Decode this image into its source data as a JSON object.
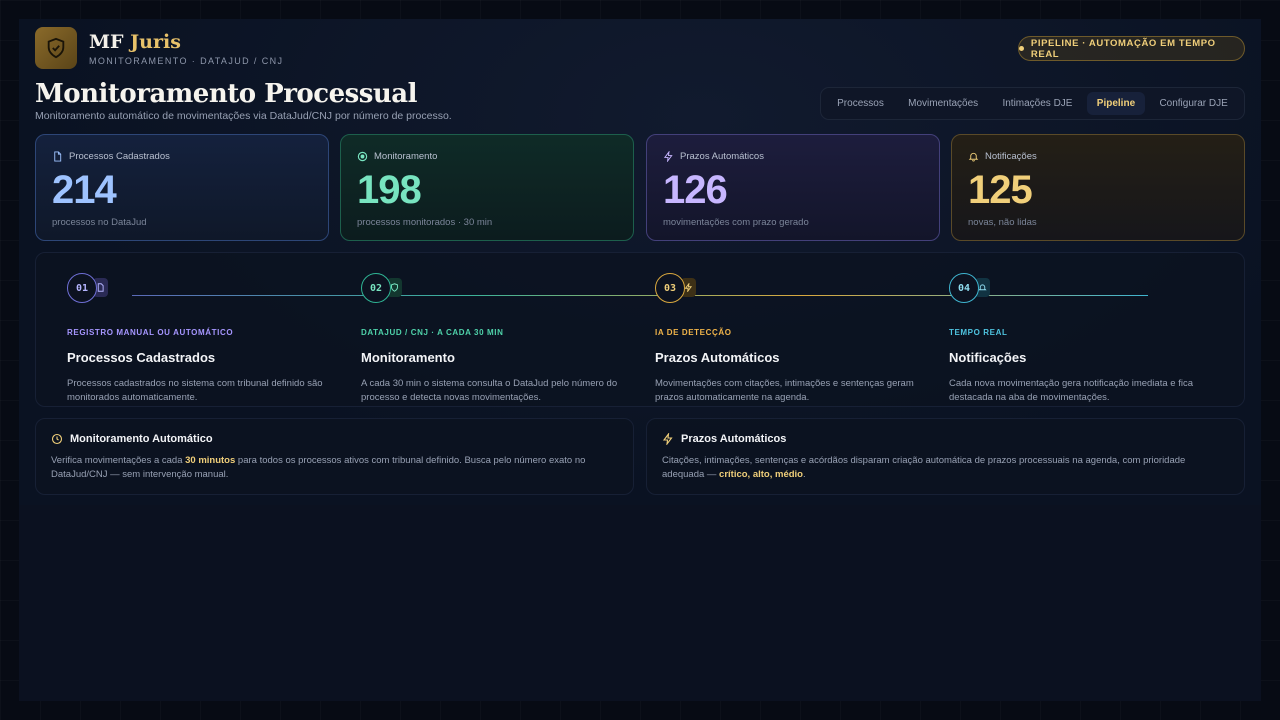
{
  "brand": {
    "name_part1": "MF",
    "name_part2": "Juris",
    "subtitle": "MONITORAMENTO · DATAJUD / CNJ"
  },
  "header": {
    "pill": "PIPELINE · AUTOMAÇÃO EM TEMPO REAL",
    "title": "Monitoramento Processual",
    "subtitle": "Monitoramento automático de movimentações via DataJud/CNJ por número de processo."
  },
  "tabs": [
    {
      "label": "Processos"
    },
    {
      "label": "Movimentações"
    },
    {
      "label": "Intimações DJE"
    },
    {
      "label": "Pipeline",
      "active": true
    },
    {
      "label": "Configurar DJE"
    }
  ],
  "stats": [
    {
      "label": "Processos Cadastrados",
      "value": "214",
      "desc": "processos no DataJud",
      "icon": "document-icon",
      "color": "#9ec3ff"
    },
    {
      "label": "Monitoramento",
      "value": "198",
      "desc": "processos monitorados · 30 min",
      "icon": "target-icon",
      "color": "#78e4c0"
    },
    {
      "label": "Prazos Automáticos",
      "value": "126",
      "desc": "movimentações com prazo gerado",
      "icon": "bolt-icon",
      "color": "#c7b6ff"
    },
    {
      "label": "Notificações",
      "value": "125",
      "desc": "novas, não lidas",
      "icon": "bell-icon",
      "color": "#f0cf7a"
    }
  ],
  "steps": [
    {
      "num": "01",
      "tag": "REGISTRO MANUAL OU AUTOMÁTICO",
      "name": "Processos Cadastrados",
      "text": "Processos cadastrados no sistema com tribunal definido são monitorados automaticamente."
    },
    {
      "num": "02",
      "tag": "DATAJUD / CNJ · A CADA 30 MIN",
      "name": "Monitoramento",
      "text": "A cada 30 min o sistema consulta o DataJud pelo número do processo e detecta novas movimentações."
    },
    {
      "num": "03",
      "tag": "IA DE DETECÇÃO",
      "name": "Prazos Automáticos",
      "text": "Movimentações com citações, intimações e sentenças geram prazos automaticamente na agenda."
    },
    {
      "num": "04",
      "tag": "TEMPO REAL",
      "name": "Notificações",
      "text": "Cada nova movimentação gera notificação imediata e fica destacada na aba de movimentações."
    }
  ],
  "info": {
    "monitor": {
      "title": "Monitoramento Automático",
      "text_before": "Verifica movimentações a cada ",
      "highlight": "30 minutos",
      "text_after": " para todos os processos ativos com tribunal definido. Busca pelo número exato no DataJud/CNJ — sem intervenção manual."
    },
    "prazos": {
      "title": "Prazos Automáticos",
      "text_before": "Citações, intimações, sentenças e acórdãos disparam criação automática de prazos processuais na agenda, com prioridade adequada — ",
      "highlight": "crítico, alto, médio",
      "text_after": "."
    }
  }
}
